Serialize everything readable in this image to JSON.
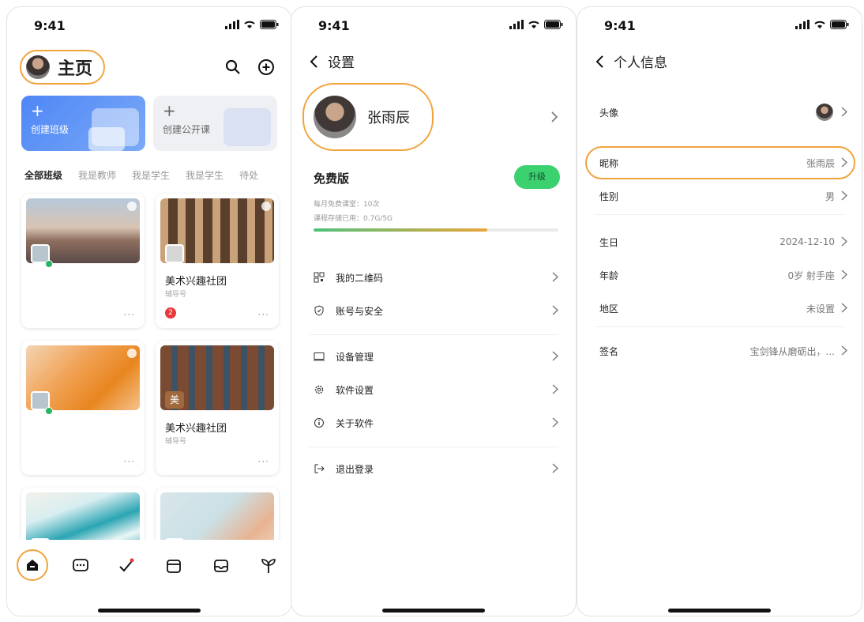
{
  "status": {
    "time": "9:41"
  },
  "home": {
    "title": "主页",
    "create_class": "创建班级",
    "create_public": "创建公开课",
    "filters": [
      "全部班级",
      "我是教师",
      "我是学生",
      "我是学生",
      "待处"
    ],
    "cards": [
      {
        "title": "",
        "subtitle": ""
      },
      {
        "title": "美术兴趣社团",
        "subtitle": "辅导号",
        "badge": "2"
      },
      {
        "title": "",
        "subtitle": ""
      },
      {
        "title": "美术兴趣社团",
        "subtitle": "辅导号",
        "chip": "美"
      },
      {
        "title": "",
        "subtitle": ""
      },
      {
        "title": "",
        "subtitle": ""
      }
    ],
    "more": "···"
  },
  "settings": {
    "back": "设置",
    "name": "张雨辰",
    "plan": "免费版",
    "upgrade": "升级",
    "quota_lesson": "每月免费课堂：10次",
    "quota_storage": "课程存储已用：0.7G/5G",
    "storage_used_fraction": 0.71,
    "menu": [
      "我的二维码",
      "账号与安全",
      "设备管理",
      "软件设置",
      "关于软件",
      "退出登录"
    ]
  },
  "profile": {
    "back": "个人信息",
    "rows": [
      {
        "k": "头像",
        "v": ""
      },
      {
        "k": "昵称",
        "v": "张雨辰"
      },
      {
        "k": "性别",
        "v": "男"
      },
      {
        "k": "生日",
        "v": "2024-12-10"
      },
      {
        "k": "年龄",
        "v": "0岁 射手座"
      },
      {
        "k": "地区",
        "v": "未设置"
      },
      {
        "k": "签名",
        "v": "宝剑锋从磨砺出，..."
      }
    ]
  },
  "colors": {
    "highlight": "#f2a33c",
    "upgrade": "#3bd16f",
    "primary": "#4f86f5"
  }
}
